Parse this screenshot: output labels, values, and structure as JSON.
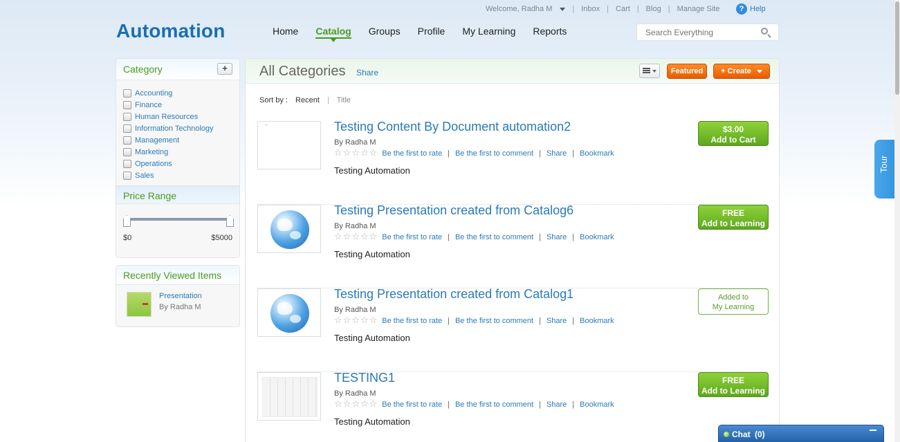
{
  "topbar": {
    "welcome": "Welcome, Radha M",
    "links": [
      "Inbox",
      "Cart",
      "Blog",
      "Manage Site"
    ],
    "help": "Help"
  },
  "logo": "Automation",
  "nav": [
    "Home",
    "Catalog",
    "Groups",
    "Profile",
    "My Learning",
    "Reports"
  ],
  "nav_active": "Catalog",
  "search": {
    "placeholder": "Search Everything"
  },
  "sidebar": {
    "category": {
      "title": "Category",
      "add_label": "+",
      "items": [
        "Accounting",
        "Finance",
        "Human Resources",
        "Information Technology",
        "Management",
        "Marketing",
        "Operations",
        "Sales"
      ]
    },
    "price": {
      "title": "Price Range",
      "min": "$0",
      "max": "$5000"
    },
    "recent": {
      "title": "Recently Viewed Items",
      "items": [
        {
          "name": "Presentation",
          "author": "By Radha M"
        }
      ]
    }
  },
  "main": {
    "title": "All Categories",
    "share": "Share",
    "featured": "Featured",
    "create": "+ Create",
    "sort": {
      "label": "Sort by :",
      "options": [
        "Recent",
        "Title"
      ]
    },
    "items": [
      {
        "title": "Testing Content By Document automation2",
        "author": "By Radha M",
        "rate": "Be the first to rate",
        "comment": "Be the first to comment",
        "share": "Share",
        "bookmark": "Bookmark",
        "desc": "Testing Automation",
        "button_line1": "$3.00",
        "button_line2": "Add to Cart"
      },
      {
        "title": "Testing Presentation created from Catalog6",
        "author": "By Radha M",
        "rate": "Be the first to rate",
        "comment": "Be the first to comment",
        "share": "Share",
        "bookmark": "Bookmark",
        "desc": "Testing Automation",
        "button_line1": "FREE",
        "button_line2": "Add to Learning"
      },
      {
        "title": "Testing Presentation created from Catalog1",
        "author": "By Radha M",
        "rate": "Be the first to rate",
        "comment": "Be the first to comment",
        "share": "Share",
        "bookmark": "Bookmark",
        "desc": "Testing Automation",
        "button_line1": "Added to",
        "button_line2": "My Learning"
      },
      {
        "title": "TESTING1",
        "author": "By Radha M",
        "rate": "Be the first to rate",
        "comment": "Be the first to comment",
        "share": "Share",
        "bookmark": "Bookmark",
        "desc": "Testing Automation",
        "button_line1": "FREE",
        "button_line2": "Add to Learning"
      }
    ]
  },
  "tour": "Tour",
  "chat": {
    "title": "Chat",
    "count": "(0)"
  },
  "colors": {
    "brand": "#1a6fb3",
    "accent_green": "#4a9a1f",
    "orange": "#e85d00",
    "link": "#2a7ab8"
  }
}
